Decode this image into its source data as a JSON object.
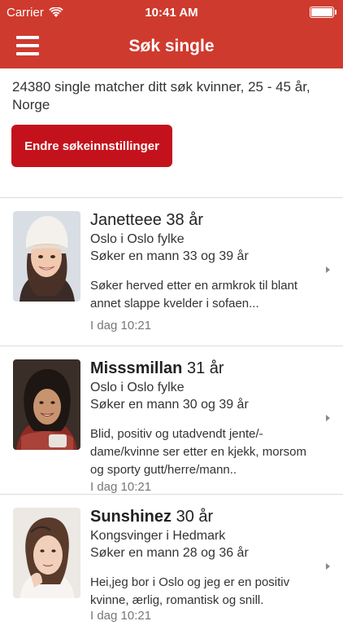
{
  "status_bar": {
    "carrier": "Carrier",
    "time": "10:41 AM"
  },
  "nav": {
    "title": "Søk single"
  },
  "summary": "24380 single matcher ditt søk kvinner, 25 - 45 år, Norge",
  "change_button": "Endre søkeinnstillinger",
  "profiles": [
    {
      "name": "Janetteee",
      "age": "38 år",
      "location": "Oslo i Oslo fylke",
      "seeking": "Søker en mann 33 og 39 år",
      "description": "Søker herved etter en armkrok til blant annet slappe kvelder i sofaen...",
      "time": "I dag 10:21"
    },
    {
      "name": "Misssmillan",
      "age": "31 år",
      "location": "Oslo i Oslo fylke",
      "seeking": "Søker en mann 30 og 39 år",
      "description": "Blid, positiv og utadvendt jente/-dame/kvinne ser etter en kjekk, morsom og sporty gutt/herre/mann..",
      "time": "I dag 10:21"
    },
    {
      "name": "Sunshinez",
      "age": "30 år",
      "location": "Kongsvinger i Hedmark",
      "seeking": "Søker en mann 28 og 36 år",
      "description": "Hei,jeg bor i Oslo og jeg er en positiv kvinne, ærlig, romantisk og snill.",
      "time": "I dag 10:21"
    }
  ],
  "colors": {
    "header": "#cf3a2e",
    "button": "#c4121c"
  }
}
